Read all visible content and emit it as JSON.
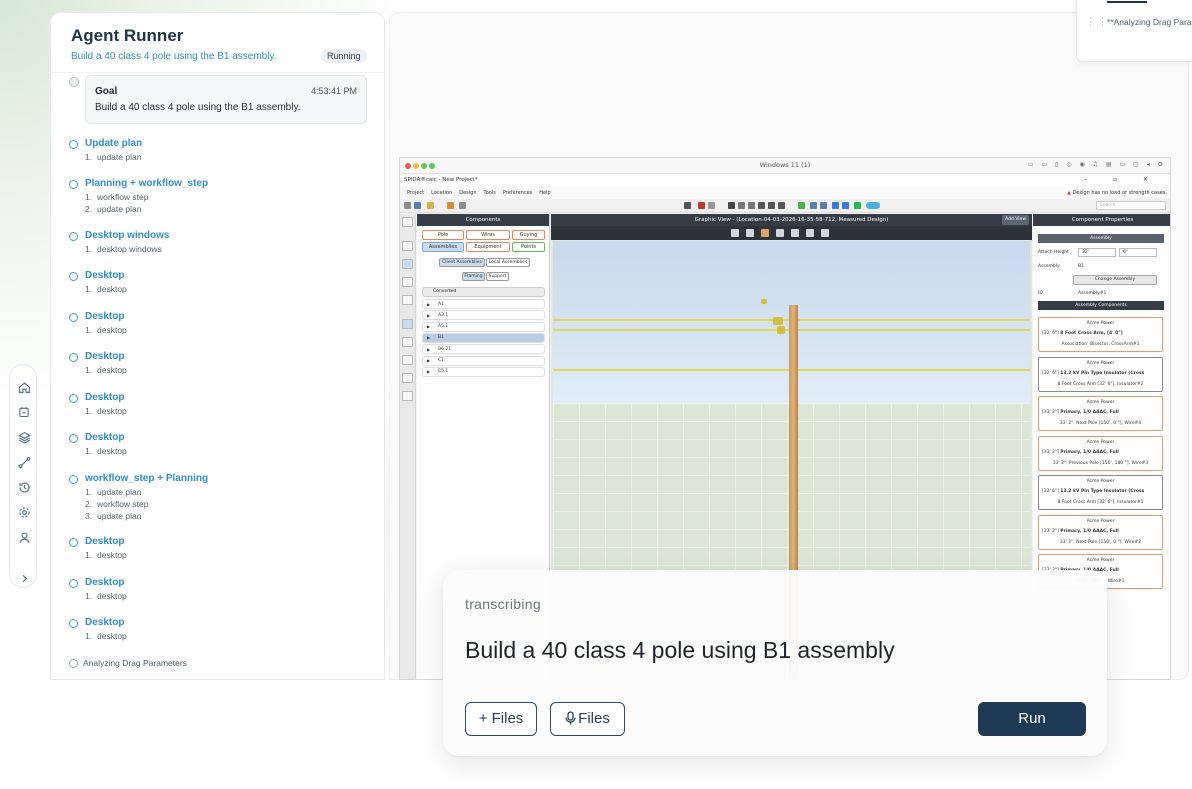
{
  "runner": {
    "title": "Agent Runner",
    "subtitle": "Build a 40 class 4 pole using the B1 assembly.",
    "status": "Running",
    "goal": {
      "label": "Goal",
      "time": "4:53:41 PM",
      "text": "Build a 40 class 4 pole using the B1 assembly."
    },
    "steps": [
      {
        "title": "Update plan",
        "subs": [
          [
            "1.",
            "update plan"
          ]
        ]
      },
      {
        "title": "Planning + workflow_step",
        "subs": [
          [
            "1.",
            "workflow step"
          ],
          [
            "2.",
            "update plan"
          ]
        ]
      },
      {
        "title": "Desktop windows",
        "subs": [
          [
            "1.",
            "desktop windows"
          ]
        ]
      },
      {
        "title": "Desktop",
        "subs": [
          [
            "1.",
            "desktop"
          ]
        ]
      },
      {
        "title": "Desktop",
        "subs": [
          [
            "1.",
            "desktop"
          ]
        ]
      },
      {
        "title": "Desktop",
        "subs": [
          [
            "1.",
            "desktop"
          ]
        ]
      },
      {
        "title": "Desktop",
        "subs": [
          [
            "1.",
            "desktop"
          ]
        ]
      },
      {
        "title": "Desktop",
        "subs": [
          [
            "1.",
            "desktop"
          ]
        ]
      },
      {
        "title": "workflow_step + Planning",
        "subs": [
          [
            "1.",
            "update plan"
          ],
          [
            "2.",
            "workflow step"
          ],
          [
            "3.",
            "update plan"
          ]
        ]
      },
      {
        "title": "Desktop",
        "subs": [
          [
            "1.",
            "desktop"
          ]
        ]
      },
      {
        "title": "Desktop",
        "subs": [
          [
            "1.",
            "desktop"
          ]
        ]
      },
      {
        "title": "Desktop",
        "subs": [
          [
            "1.",
            "desktop"
          ]
        ]
      }
    ],
    "analyzing": "Analyzing Drag Parameters"
  },
  "rail": {
    "icons": [
      "home-icon",
      "calendar-icon",
      "layers-icon",
      "route-icon",
      "history-icon",
      "settings-icon",
      "user-icon"
    ],
    "expand_icon": "chevron-right-icon"
  },
  "mini_card": {
    "text": "**Analyzing Drag Para"
  },
  "desktop": {
    "window_title": "Windows 11 (1)",
    "app_title": "SPIDA®calc - New Project*",
    "menu": [
      "Project",
      "Location",
      "Design",
      "Tools",
      "Preferences",
      "Help"
    ],
    "warning": "Design has no load or strength cases.",
    "search_placeholder": "Search",
    "components": {
      "header": "Components",
      "tabs_row1": [
        "Pole",
        "Wires",
        "Guying"
      ],
      "tabs_row2": [
        "Assemblies",
        "Equipment",
        "Points"
      ],
      "sub1": [
        "Client Assemblies",
        "Local Assemblies"
      ],
      "sub2": [
        "Framing",
        "Support"
      ],
      "tree_head": "Converted",
      "items": [
        "A1",
        "A3.1",
        "A5.1",
        "B1",
        "B6.21",
        "C1",
        "C5.1"
      ]
    },
    "graphic": {
      "header": "Graphic View - (Location-04-03-2026-16-35-58-712, Measured Design)",
      "add_view": "Add View"
    },
    "props": {
      "header": "Component Properties",
      "section": "Assembly",
      "attach_label": "Attach Height",
      "attach_ft": "32'",
      "attach_in": "6\"",
      "assembly_label": "Assembly",
      "assembly_value": "B1",
      "change_btn": "Change Assembly",
      "id_label": "ID",
      "id_value": "Assembly#1",
      "components_header": "Assembly Components",
      "cards": [
        {
          "owner": "Acme Power",
          "pre": "[32' 6\"]",
          "main": "8 Foot Cross Arm, [4' 0\"]",
          "detail": "Association: Bisector, CrossArm#1"
        },
        {
          "owner": "Acme Power",
          "pre": "[32' 6\"]",
          "main": "13.2 kV Pin Type Insulator (Cross",
          "detail": "8 Foot Cross Arm [32' 6\"], Insulator#2"
        },
        {
          "owner": "Acme Power",
          "pre": "[33' 2\"]",
          "main": "Primary, 1/0 AAAC, Full",
          "detail": "33' 2\", Next Pole [150', 0 °], Wire#4"
        },
        {
          "owner": "Acme Power",
          "pre": "[33' 2\"]",
          "main": "Primary, 1/0 AAAC, Full",
          "detail": "33' 2\", Previous Pole [150', 180 °], Wire#3"
        },
        {
          "owner": "Acme Power",
          "pre": "[32' 6\"]",
          "main": "13.2 kV Pin Type Insulator (Cross",
          "detail": "8 Foot Cross Arm [32' 6\"], Insulator#1"
        },
        {
          "owner": "Acme Power",
          "pre": "[33' 2\"]",
          "main": "Primary, 1/0 AAAC, Full",
          "detail": "33' 2\", Next Pole [150', 0 °], Wire#2"
        },
        {
          "owner": "Acme Power",
          "pre": "[33' 2\"]",
          "main": "Primary, 1/0 AAAC, Full",
          "detail": "[150', 180 °], Wire#1"
        }
      ]
    }
  },
  "transcribe": {
    "status": "transcribing",
    "prompt": "Build a 40 class 4 pole using B1 assembly",
    "files_label": "+ Files",
    "mic_files_label": "Files",
    "run_label": "Run"
  },
  "colors": {
    "accent_blue": "#2e8ec4",
    "run_button": "#1e3a54",
    "title_navy": "#1e3446"
  }
}
